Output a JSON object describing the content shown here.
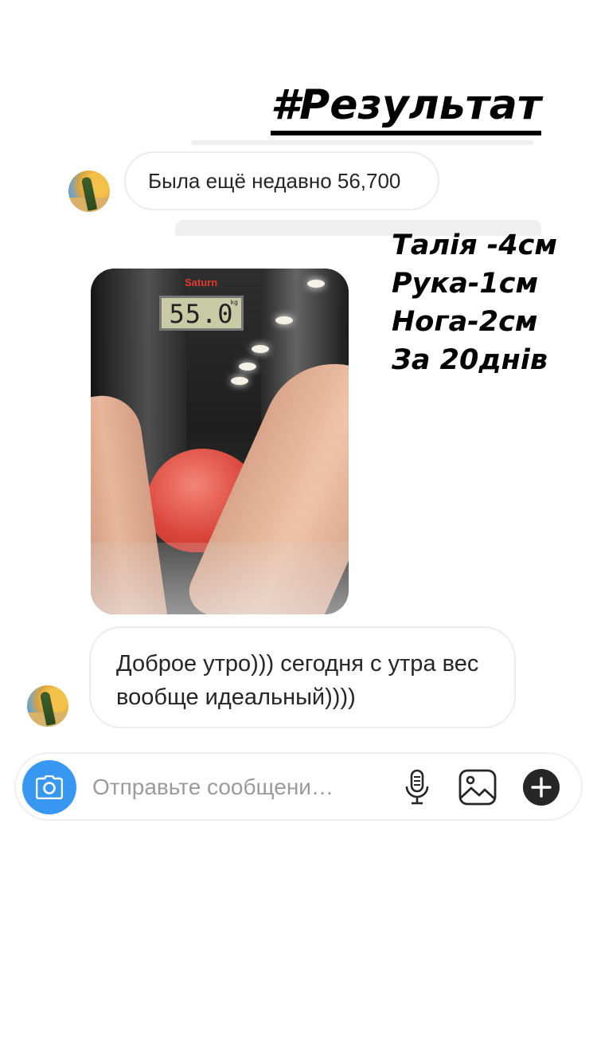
{
  "story": {
    "hashtag": "#Результат",
    "stats": [
      "Талія -4см",
      "Рука-1см",
      "Нога-2см",
      "За 20днів"
    ]
  },
  "messages": [
    {
      "type": "text",
      "text": "Была ещё недавно 56,700"
    },
    {
      "type": "photo",
      "brand": "Saturn",
      "scale_reading": "55.0",
      "scale_unit": "kg"
    },
    {
      "type": "text",
      "text": "Доброе утро))) сегодня с утра вес вообще идеальный))))"
    }
  ],
  "composer": {
    "placeholder": "Отправьте сообщени…",
    "icons": [
      "camera-icon",
      "microphone-icon",
      "gallery-icon",
      "plus-icon"
    ],
    "accent_color": "#3897f0"
  }
}
